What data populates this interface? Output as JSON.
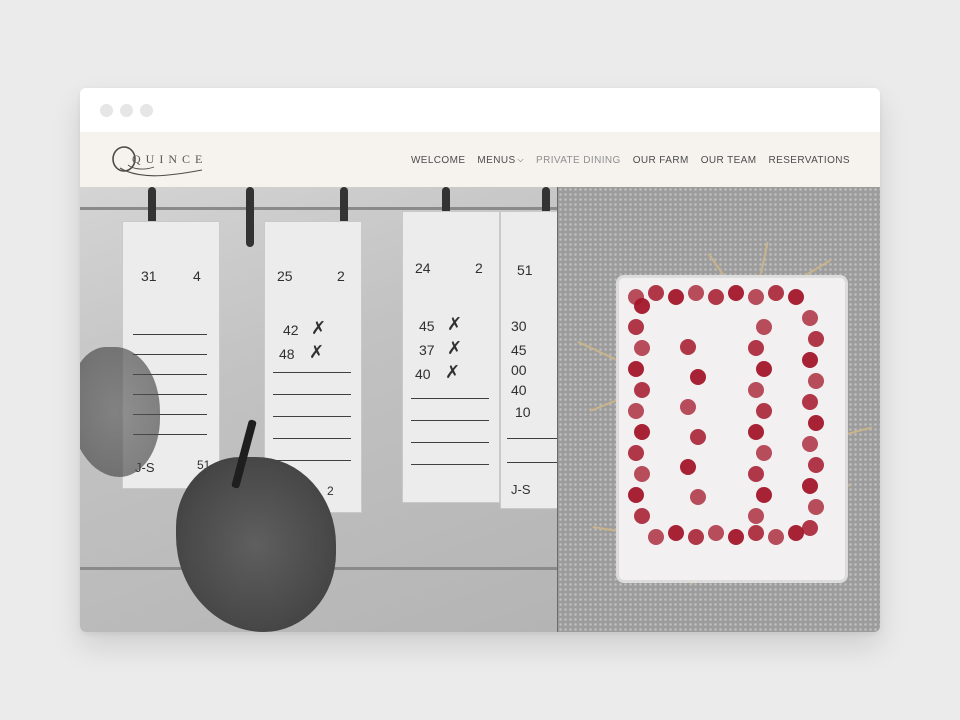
{
  "window": {
    "controls": [
      "close",
      "minimize",
      "maximize"
    ]
  },
  "site": {
    "logo_text": "QUINCE",
    "nav": [
      {
        "label": "WELCOME"
      },
      {
        "label": "MENUS",
        "has_dropdown": true,
        "icon": "chevron-down-icon"
      },
      {
        "label": "PRIVATE DINING"
      },
      {
        "label": "OUR FARM"
      },
      {
        "label": "OUR TEAM"
      },
      {
        "label": "RESERVATIONS"
      }
    ]
  },
  "hero": {
    "tickets": [
      {
        "top_left": "31",
        "top_right": "4",
        "bottom_left": "J-S",
        "bottom_right": "51"
      },
      {
        "top_left": "25",
        "top_right": "2",
        "entries": [
          "42",
          "48"
        ],
        "bottom_right": "2"
      },
      {
        "top_left": "24",
        "top_right": "2",
        "entries": [
          "45",
          "37",
          "40"
        ]
      },
      {
        "top_left": "51",
        "entries": [
          "30",
          "45",
          "00",
          "40",
          "10"
        ],
        "bottom_left": "J-S"
      }
    ]
  },
  "colors": {
    "page_bg": "#ebebeb",
    "header_bg": "#f6f3ef",
    "nav_text": "#4c4c4c",
    "nav_dim": "#8f8f8f",
    "candy_red": "#a3162a"
  }
}
